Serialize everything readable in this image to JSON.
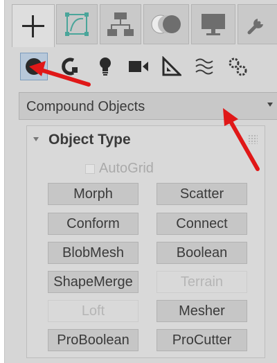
{
  "tabs": [
    {
      "name": "create",
      "icon": "plus-icon",
      "active": true
    },
    {
      "name": "modify",
      "icon": "modify-curve-icon",
      "active": false
    },
    {
      "name": "hierarchy",
      "icon": "hierarchy-icon",
      "active": false
    },
    {
      "name": "motion",
      "icon": "motion-icon",
      "active": false
    },
    {
      "name": "display",
      "icon": "display-monitor-icon",
      "active": false
    },
    {
      "name": "utilities",
      "icon": "wrench-icon",
      "active": false
    }
  ],
  "categories": [
    {
      "name": "geometry",
      "icon": "sphere-icon",
      "active": true
    },
    {
      "name": "shapes",
      "icon": "shapes-icon",
      "active": false
    },
    {
      "name": "lights",
      "icon": "light-bulb-icon",
      "active": false
    },
    {
      "name": "cameras",
      "icon": "camera-icon",
      "active": false
    },
    {
      "name": "helpers",
      "icon": "helpers-ruler-icon",
      "active": false
    },
    {
      "name": "space-warps",
      "icon": "space-warps-icon",
      "active": false
    },
    {
      "name": "systems",
      "icon": "gears-icon",
      "active": false
    }
  ],
  "dropdown": {
    "selected": "Compound Objects"
  },
  "rollout": {
    "title": "Object Type",
    "autogrid_label": "AutoGrid",
    "autogrid_checked": false,
    "autogrid_enabled": false,
    "buttons": [
      {
        "label": "Morph",
        "enabled": true
      },
      {
        "label": "Scatter",
        "enabled": true
      },
      {
        "label": "Conform",
        "enabled": true
      },
      {
        "label": "Connect",
        "enabled": true
      },
      {
        "label": "BlobMesh",
        "enabled": true
      },
      {
        "label": "Boolean",
        "enabled": true
      },
      {
        "label": "ShapeMerge",
        "enabled": true
      },
      {
        "label": "Terrain",
        "enabled": false
      },
      {
        "label": "Loft",
        "enabled": false
      },
      {
        "label": "Mesher",
        "enabled": true
      },
      {
        "label": "ProBoolean",
        "enabled": true
      },
      {
        "label": "ProCutter",
        "enabled": true
      }
    ]
  },
  "colors": {
    "panel_bg": "#d6d6d6",
    "active_category_bg": "#b7c8da",
    "annotation_arrow": "#e01818",
    "teal_icon": "#4aa59a"
  }
}
